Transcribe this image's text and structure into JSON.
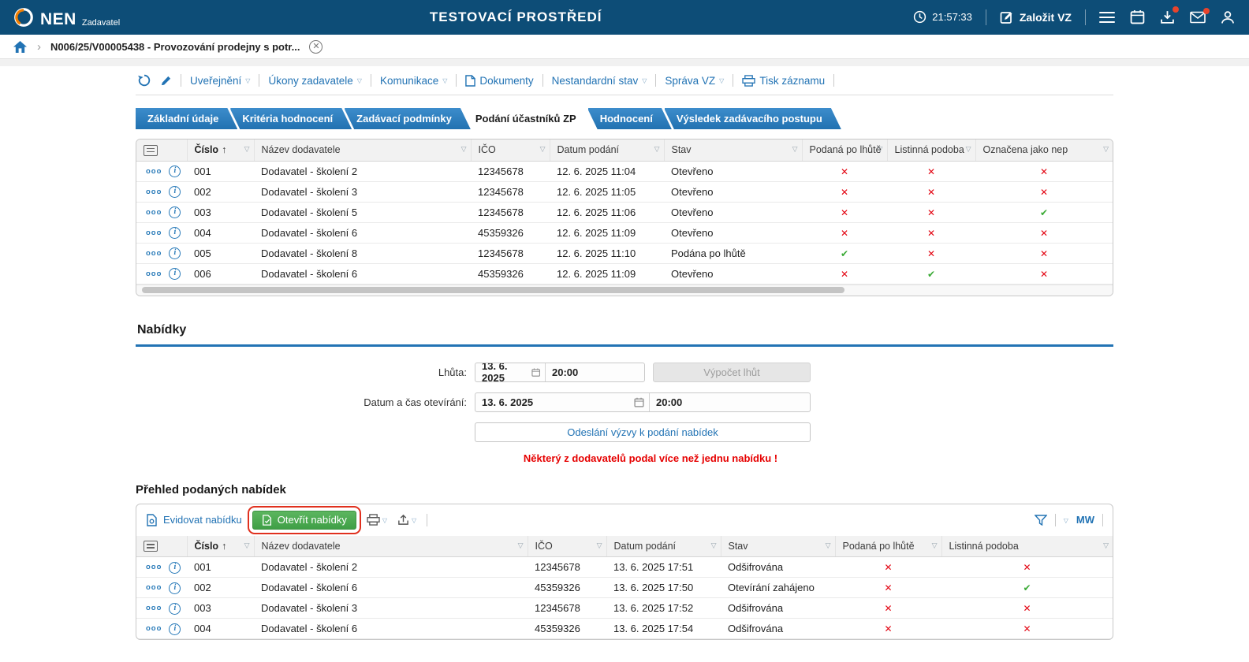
{
  "colors": {
    "header_bar": "#0d4d77",
    "accent_blue": "#2273b4",
    "success_green": "#3aaa35",
    "error_red": "#e30613",
    "button_green": "#48a94d"
  },
  "header": {
    "app_name": "NEN",
    "app_role": "Zadavatel",
    "env_title": "TESTOVACÍ PROSTŘEDÍ",
    "time": "21:57:33",
    "new_vz_label": "Založit VZ"
  },
  "breadcrumb": {
    "item_label": "N006/25/V00005438 - Provozování prodejny s potr..."
  },
  "record_toolbar": {
    "items": [
      {
        "label": "Uveřejnění",
        "dropdown": true
      },
      {
        "label": "Úkony zadavatele",
        "dropdown": true
      },
      {
        "label": "Komunikace",
        "dropdown": true
      },
      {
        "label": "Dokumenty",
        "dropdown": false
      },
      {
        "label": "Nestandardní stav",
        "dropdown": true
      },
      {
        "label": "Správa VZ",
        "dropdown": true
      },
      {
        "label": "Tisk záznamu",
        "dropdown": false
      }
    ]
  },
  "tabs": [
    {
      "label": "Základní údaje",
      "active": false
    },
    {
      "label": "Kritéria hodnocení",
      "active": false
    },
    {
      "label": "Zadávací podmínky",
      "active": false
    },
    {
      "label": "Podání účastníků ZP",
      "active": true
    },
    {
      "label": "Hodnocení",
      "active": false
    },
    {
      "label": "Výsledek zadávacího postupu",
      "active": false
    }
  ],
  "submissions_table": {
    "columns": [
      {
        "label": "Číslo",
        "type": "text",
        "sorted": true
      },
      {
        "label": "Název dodavatele",
        "type": "text"
      },
      {
        "label": "IČO",
        "type": "text"
      },
      {
        "label": "Datum podání",
        "type": "text"
      },
      {
        "label": "Stav",
        "type": "text"
      },
      {
        "label": "Podaná po lhůtě",
        "type": "flag"
      },
      {
        "label": "Listinná podoba",
        "type": "flag"
      },
      {
        "label": "Označena jako nep",
        "type": "flag"
      }
    ],
    "rows": [
      [
        "001",
        "Dodavatel - školení 2",
        "12345678",
        "12. 6. 2025 11:04",
        "Otevřeno",
        "no",
        "no",
        "no"
      ],
      [
        "002",
        "Dodavatel - školení 3",
        "12345678",
        "12. 6. 2025 11:05",
        "Otevřeno",
        "no",
        "no",
        "no"
      ],
      [
        "003",
        "Dodavatel - školení 5",
        "12345678",
        "12. 6. 2025 11:06",
        "Otevřeno",
        "no",
        "no",
        "yes"
      ],
      [
        "004",
        "Dodavatel - školení 6",
        "45359326",
        "12. 6. 2025 11:09",
        "Otevřeno",
        "no",
        "no",
        "no"
      ],
      [
        "005",
        "Dodavatel - školení 8",
        "12345678",
        "12. 6. 2025 11:10",
        "Podána po lhůtě",
        "yes",
        "no",
        "no"
      ],
      [
        "006",
        "Dodavatel - školení 6",
        "45359326",
        "12. 6. 2025 11:09",
        "Otevřeno",
        "no",
        "yes",
        "no"
      ]
    ]
  },
  "offers_section": {
    "title": "Nabídky",
    "deadline_label": "Lhůta:",
    "deadline_date": "13. 6. 2025",
    "deadline_time": "20:00",
    "calc_button": "Výpočet lhůt",
    "opening_label": "Datum a čas otevírání:",
    "opening_date": "13. 6. 2025",
    "opening_time": "20:00",
    "send_invite_button": "Odeslání výzvy k podání nabídek",
    "warning": "Některý z dodavatelů podal více než jednu nabídku !"
  },
  "offers_overview": {
    "title": "Přehled podaných nabídek",
    "register_button": "Evidovat nabídku",
    "open_button": "Otevřít nabídky",
    "user_initials": "MW"
  },
  "offers_table": {
    "columns": [
      {
        "label": "Číslo",
        "type": "text",
        "sorted": true
      },
      {
        "label": "Název dodavatele",
        "type": "text"
      },
      {
        "label": "IČO",
        "type": "text"
      },
      {
        "label": "Datum podání",
        "type": "text"
      },
      {
        "label": "Stav",
        "type": "text"
      },
      {
        "label": "Podaná po lhůtě",
        "type": "flag"
      },
      {
        "label": "Listinná podoba",
        "type": "flag"
      }
    ],
    "rows": [
      [
        "001",
        "Dodavatel - školení 2",
        "12345678",
        "13. 6. 2025 17:51",
        "Odšifrována",
        "no",
        "no"
      ],
      [
        "002",
        "Dodavatel - školení 6",
        "45359326",
        "13. 6. 2025 17:50",
        "Otevírání zahájeno",
        "no",
        "yes"
      ],
      [
        "003",
        "Dodavatel - školení 3",
        "12345678",
        "13. 6. 2025 17:52",
        "Odšifrována",
        "no",
        "no"
      ],
      [
        "004",
        "Dodavatel - školení 6",
        "45359326",
        "13. 6. 2025 17:54",
        "Odšifrována",
        "no",
        "no"
      ]
    ]
  }
}
